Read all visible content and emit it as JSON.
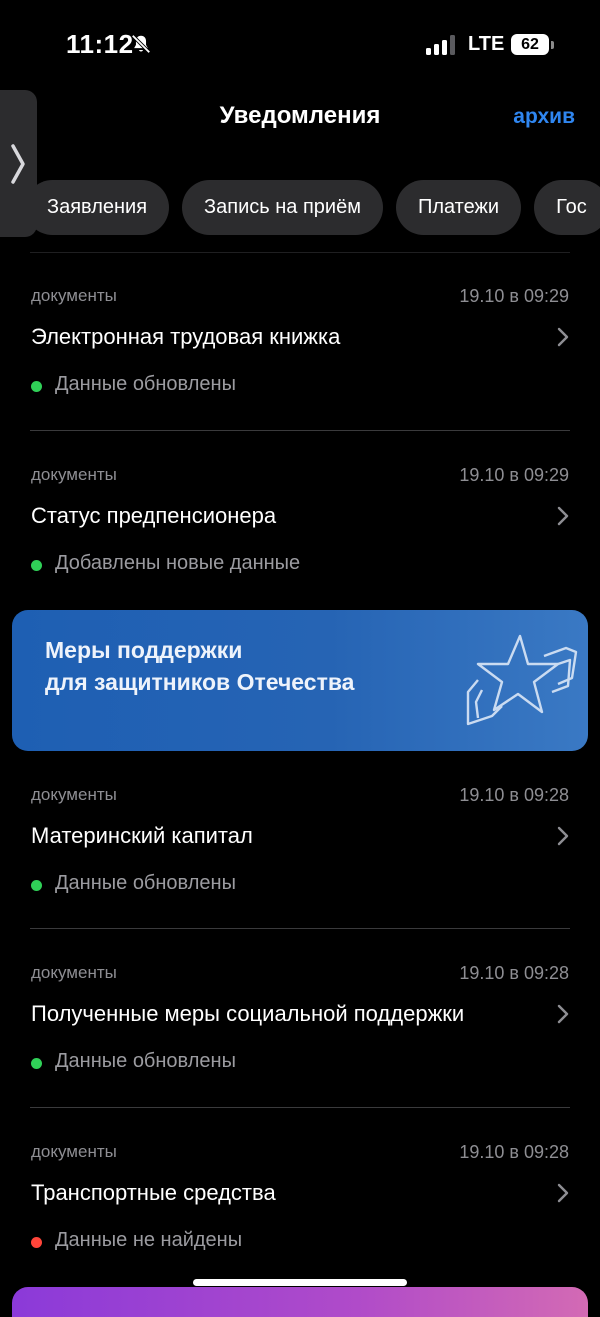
{
  "status_bar": {
    "time": "11:12",
    "network": "LTE",
    "battery": "62"
  },
  "header": {
    "title": "Уведомления",
    "archive_label": "архив"
  },
  "filters": [
    {
      "label": "Заявления"
    },
    {
      "label": "Запись на приём"
    },
    {
      "label": "Платежи"
    },
    {
      "label": "Гос"
    }
  ],
  "notifications": [
    {
      "category": "документы",
      "time": "19.10 в 09:29",
      "title": "Электронная трудовая книжка",
      "status": "Данные обновлены",
      "status_color": "#30d158"
    },
    {
      "category": "документы",
      "time": "19.10 в 09:29",
      "title": "Статус предпенсионера",
      "status": "Добавлены новые данные",
      "status_color": "#30d158"
    },
    {
      "category": "документы",
      "time": "19.10 в 09:28",
      "title": "Материнский капитал",
      "status": "Данные обновлены",
      "status_color": "#30d158"
    },
    {
      "category": "документы",
      "time": "19.10 в 09:28",
      "title": "Полученные меры социальной поддержки",
      "status": "Данные обновлены",
      "status_color": "#30d158"
    },
    {
      "category": "документы",
      "time": "19.10 в 09:28",
      "title": "Транспортные средства",
      "status": "Данные не найдены",
      "status_color": "#ff453a"
    }
  ],
  "banner": {
    "line1": "Меры поддержки",
    "line2": "для защитников Отечества"
  },
  "colors": {
    "accent": "#2f86f0",
    "ok": "#30d158",
    "error": "#ff453a"
  },
  "icons": {
    "notifications_muted": "bell-slash-icon",
    "side_panel": "chevron-right-icon",
    "item_arrow": "chevron-right-icon"
  }
}
